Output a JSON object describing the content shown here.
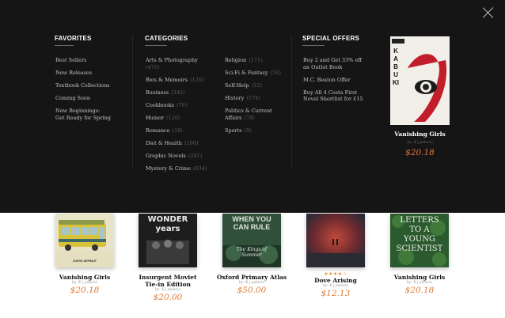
{
  "menu": {
    "favorites": {
      "title": "FAVORITES",
      "items": [
        "Best Sellers",
        "New Releases",
        "Textbook Collections",
        "Coming Soon",
        "New Beginnings:",
        "Get Ready for Spring"
      ]
    },
    "categories": {
      "title": "CATEGORIES",
      "left": [
        {
          "label": "Arts & Photography",
          "count": "(476)"
        },
        {
          "label": "Bios & Memoirs",
          "count": "(120)"
        },
        {
          "label": "Business",
          "count": "(345)"
        },
        {
          "label": "Cookbooks",
          "count": "(76)"
        },
        {
          "label": "Humor",
          "count": "(120)"
        },
        {
          "label": "Romance",
          "count": "(18)"
        },
        {
          "label": "Diet & Health",
          "count": "(100)"
        },
        {
          "label": "Graphic Novels",
          "count": "(281)"
        },
        {
          "label": "Mystery & Crime",
          "count": "(634)"
        }
      ],
      "right": [
        {
          "label": "Religion",
          "count": "(171)"
        },
        {
          "label": "Sci-Fi & Fantasy",
          "count": "(56)"
        },
        {
          "label": "Self-Help",
          "count": "(12)"
        },
        {
          "label": "History",
          "count": "(174)"
        },
        {
          "label": "Politics & Current",
          "count": ""
        },
        {
          "label": "Affairs",
          "count": "(78)"
        },
        {
          "label": "Sports",
          "count": "(9)"
        }
      ]
    },
    "special_offers": {
      "title": "SPECIAL OFFERS",
      "items": [
        "Buy 2 and Get 33% off",
        "an Outlet Book",
        "M.C. Beaton Offer",
        "Buy All 4 Costa First",
        "Novel Shortlist for £15"
      ]
    },
    "featured": {
      "cover_text": "KABUKI",
      "title": "Vanishing Girls",
      "by": "by: K j palacio",
      "price": "$20.18"
    }
  },
  "books": [
    {
      "title": "Vanishing Girls",
      "title2": "",
      "by": "by: K j palacio",
      "price": "$20.18",
      "cover_text": "DAVID AEHNLE"
    },
    {
      "title": "Insurgent Moviet",
      "title2": "Tie-in Edition",
      "by": "by: K j palacio",
      "price": "$20.00",
      "cover_text": "WONDER years"
    },
    {
      "title": "Oxford Primary Atlas",
      "title2": "",
      "by": "by: K j palacio",
      "price": "$50.00",
      "cover_text": "WHEN YOU CAN RULE",
      "cover_sub": "The Kings of Summer"
    },
    {
      "title": "Dove Arising",
      "title2": "",
      "by": "by: K j palacio",
      "price": "$12.13",
      "stars": "★★★★☆"
    },
    {
      "title": "Vanishing Girls",
      "title2": "",
      "by": "by: K j palacio",
      "price": "$20.18",
      "cover_text": "LETTERS TO A YOUNG SCIENTIST"
    }
  ]
}
